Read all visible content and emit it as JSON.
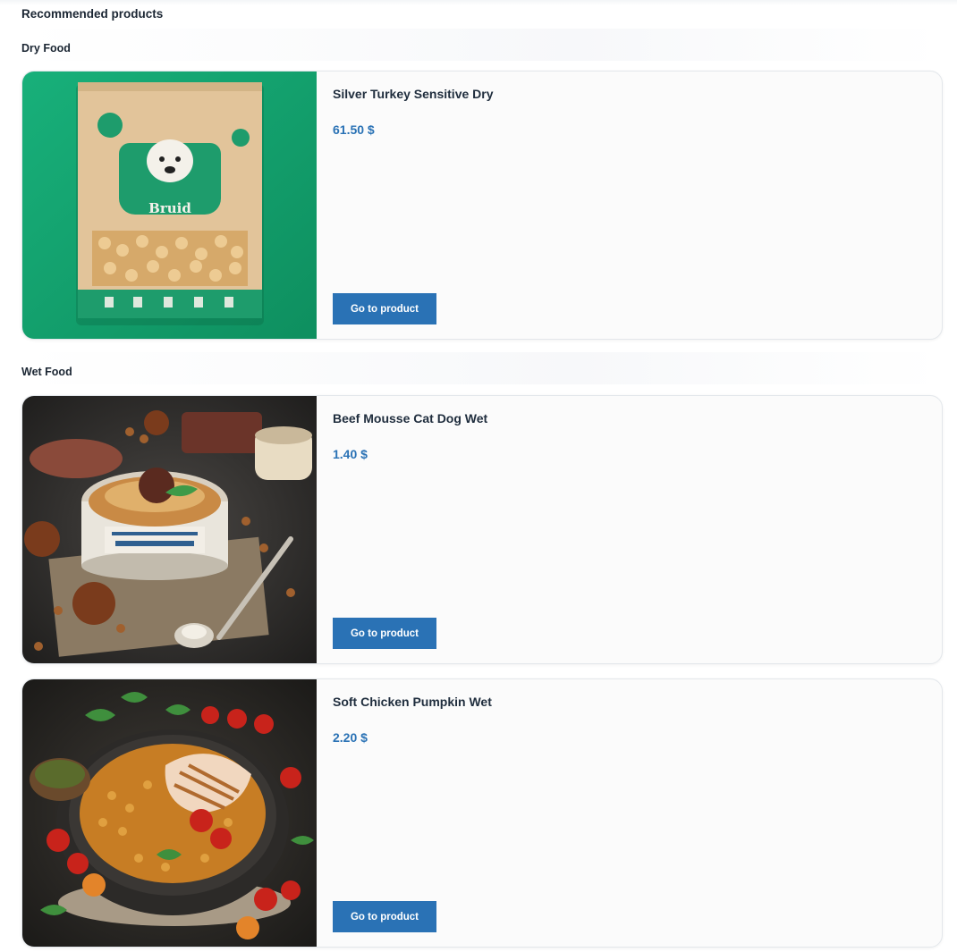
{
  "section_title": "Recommended products",
  "categories": [
    {
      "label": "Dry Food",
      "products": [
        {
          "name": "Silver Turkey Sensitive Dry",
          "price": "61.50 $",
          "button_label": "Go to product",
          "image_icon": "dog-food-bag-image",
          "image_text": "Bruid"
        }
      ]
    },
    {
      "label": "Wet Food",
      "products": [
        {
          "name": "Beef Mousse Cat Dog Wet",
          "price": "1.40 $",
          "button_label": "Go to product",
          "image_icon": "beef-mousse-can-image"
        },
        {
          "name": "Soft Chicken Pumpkin Wet",
          "price": "2.20 $",
          "button_label": "Go to product",
          "image_icon": "chicken-pumpkin-bowl-image"
        }
      ]
    }
  ],
  "colors": {
    "accent": "#2a72b5",
    "text": "#1f2d3d",
    "card_bg": "#fbfbfb",
    "card_border": "#e3e7eb"
  }
}
